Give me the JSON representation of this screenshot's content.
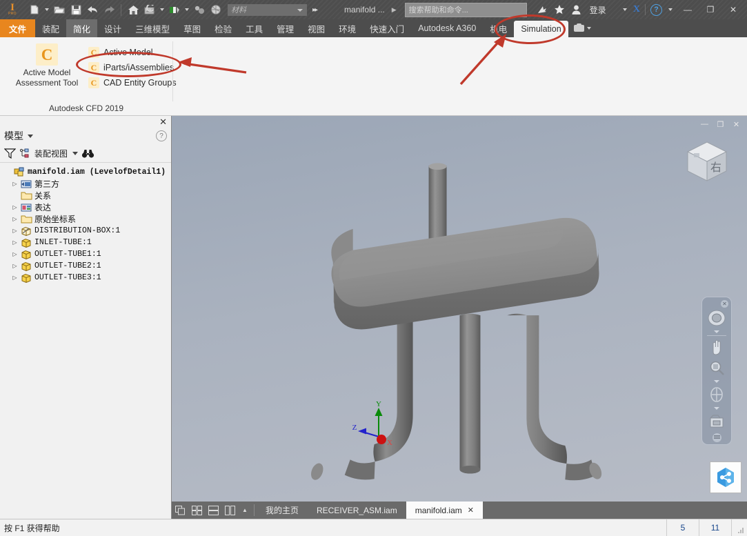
{
  "titlebar": {
    "logo_primary": "I",
    "logo_secondary": "PRO",
    "document_title": "manifold ...",
    "search_placeholder": "搜索帮助和命令...",
    "material_placeholder": "材料",
    "signin_label": "登录",
    "brand_mark": "X",
    "help_mark": "?",
    "minimize": "—",
    "restore": "❐",
    "close": "✕"
  },
  "ribbon_tabs": [
    {
      "label": "文件",
      "state": "file"
    },
    {
      "label": "装配",
      "state": "normal"
    },
    {
      "label": "简化",
      "state": "highlighted"
    },
    {
      "label": "设计",
      "state": "normal"
    },
    {
      "label": "三维模型",
      "state": "normal"
    },
    {
      "label": "草图",
      "state": "normal"
    },
    {
      "label": "检验",
      "state": "normal"
    },
    {
      "label": "工具",
      "state": "normal"
    },
    {
      "label": "管理",
      "state": "normal"
    },
    {
      "label": "视图",
      "state": "normal"
    },
    {
      "label": "环境",
      "state": "normal"
    },
    {
      "label": "快速入门",
      "state": "normal"
    },
    {
      "label": "Autodesk A360",
      "state": "normal"
    },
    {
      "label": "机电",
      "state": "normal"
    },
    {
      "label": "Simulation",
      "state": "active"
    }
  ],
  "ribbon_panel": {
    "big_button": {
      "icon": "C",
      "line1": "Active Model",
      "line2": "Assessment Tool"
    },
    "commands": [
      {
        "icon": "C",
        "label": "Active Model"
      },
      {
        "icon": "C",
        "label": "iParts/iAssemblies"
      },
      {
        "icon": "C",
        "label": "CAD Entity Groups"
      }
    ],
    "panel_title": "Autodesk CFD 2019"
  },
  "browser": {
    "title": "模型",
    "help_mark": "?",
    "filter_icon": "filter-icon",
    "view_label": "装配视图",
    "find_icon": "binoculars-icon",
    "tree": [
      {
        "label": "manifold.iam  (LevelofDetail1)",
        "icon": "assembly-icon",
        "arrow": "",
        "indent": 0,
        "script": "mono",
        "root": true
      },
      {
        "label": "第三方",
        "icon": "thirdparty-icon",
        "arrow": "▷",
        "indent": 1,
        "script": "cjk",
        "root": false
      },
      {
        "label": "关系",
        "icon": "folder-icon",
        "arrow": "",
        "indent": 1,
        "script": "cjk",
        "root": false
      },
      {
        "label": "表达",
        "icon": "representation-icon",
        "arrow": "▷",
        "indent": 1,
        "script": "cjk",
        "root": false
      },
      {
        "label": "原始坐标系",
        "icon": "folder-icon",
        "arrow": "▷",
        "indent": 1,
        "script": "cjk",
        "root": false
      },
      {
        "label": "DISTRIBUTION-BOX:1",
        "icon": "part-shaded-icon",
        "arrow": "▷",
        "indent": 1,
        "script": "mono",
        "root": false
      },
      {
        "label": "INLET-TUBE:1",
        "icon": "part-icon",
        "arrow": "▷",
        "indent": 1,
        "script": "mono",
        "root": false
      },
      {
        "label": "OUTLET-TUBE1:1",
        "icon": "part-icon",
        "arrow": "▷",
        "indent": 1,
        "script": "mono",
        "root": false
      },
      {
        "label": "OUTLET-TUBE2:1",
        "icon": "part-icon",
        "arrow": "▷",
        "indent": 1,
        "script": "mono",
        "root": false
      },
      {
        "label": "OUTLET-TUBE3:1",
        "icon": "part-icon",
        "arrow": "▷",
        "indent": 1,
        "script": "mono",
        "root": false
      }
    ]
  },
  "viewport": {
    "viewcube_face": "右",
    "axis_x": "X",
    "axis_y": "Y",
    "axis_z": "Z",
    "window_minimize": "—",
    "window_restore": "❐",
    "window_close": "✕",
    "navbar_close": "✕"
  },
  "doc_tabs": {
    "tabs": [
      {
        "label": "我的主页",
        "active": false,
        "closable": false
      },
      {
        "label": "RECEIVER_ASM.iam",
        "active": false,
        "closable": false
      },
      {
        "label": "manifold.iam",
        "active": true,
        "closable": true
      }
    ],
    "close_mark": "✕"
  },
  "statusbar": {
    "message": "按 F1 获得帮助",
    "count_1": "5",
    "count_2": "11"
  },
  "colors": {
    "accent_orange": "#e8861e",
    "annotation_red": "#c0392b",
    "cfd_icon": "#e8951c",
    "titlebar_bg": "#4d4d4d",
    "model_gray": "#8a8a8a",
    "viewport_bg": "#aab2bf",
    "status_number": "#15448a"
  }
}
